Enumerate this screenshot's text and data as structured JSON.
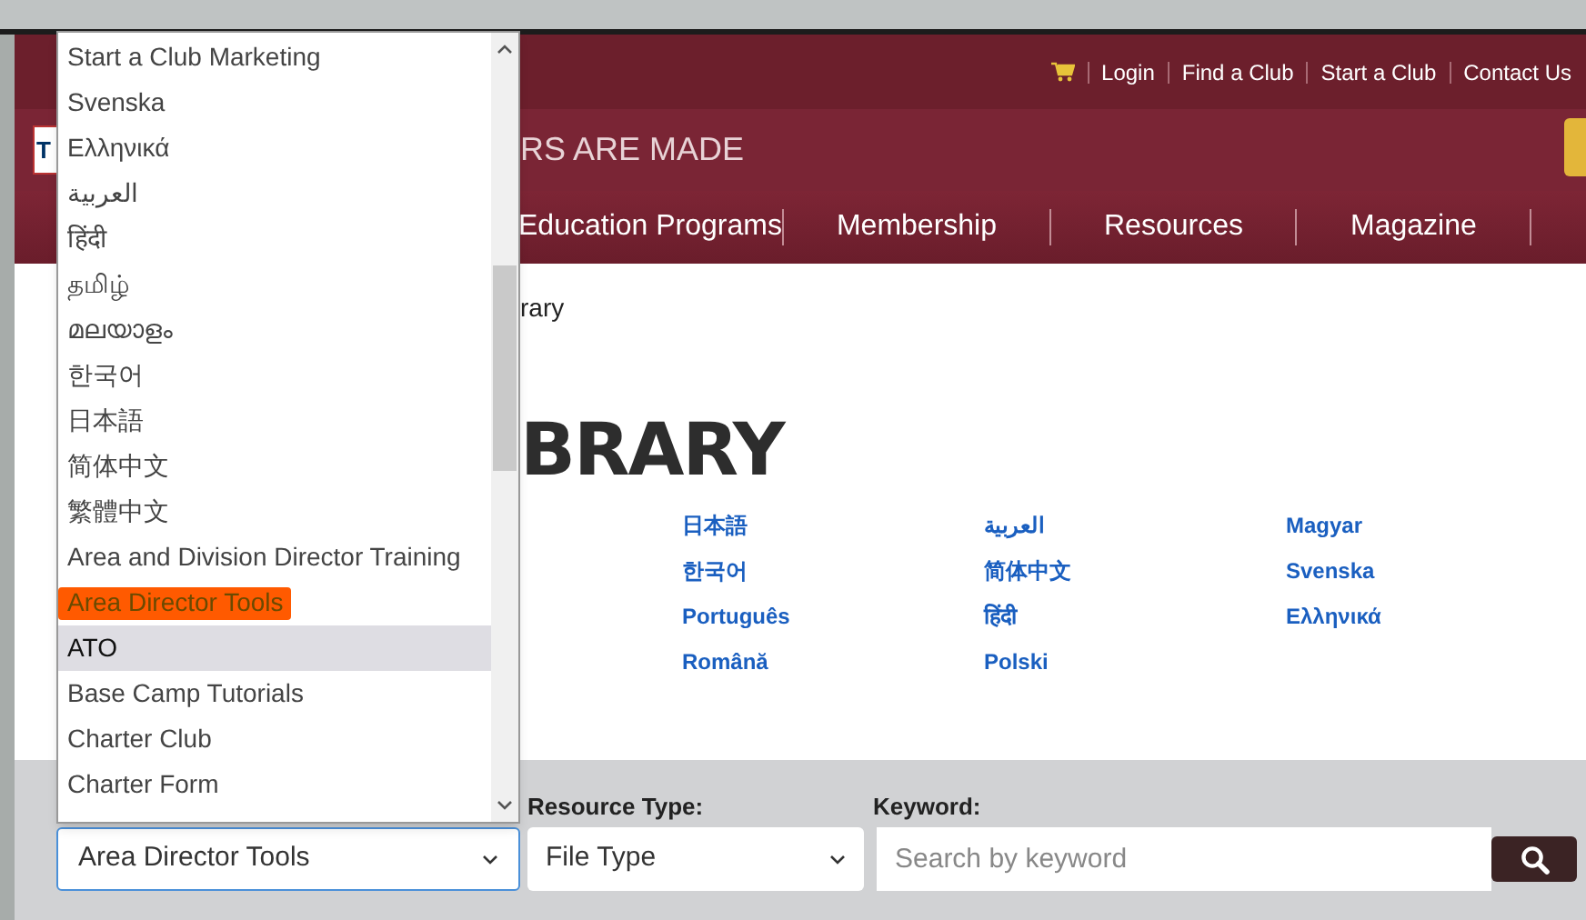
{
  "top_bar": {
    "links": [
      "Login",
      "Find a Club",
      "Start a Club",
      "Contact Us"
    ]
  },
  "header": {
    "logo_letter": "T",
    "tagline": "RS ARE MADE"
  },
  "nav": [
    "Education Programs",
    "Membership",
    "Resources",
    "Magazine"
  ],
  "breadcrumb": "rary",
  "heading": "BRARY",
  "languages": [
    [
      "日本語",
      "한국어",
      "Português",
      "Română"
    ],
    [
      "العربية",
      "简体中文",
      "हिंदी",
      "Polski"
    ],
    [
      "Magyar",
      "Svenska",
      "Ελληνικά"
    ]
  ],
  "filters": {
    "category": {
      "value": "Area Director Tools",
      "focused": true
    },
    "resource_type": {
      "label": "Resource Type:",
      "value": "File Type"
    },
    "keyword": {
      "label": "Keyword:",
      "placeholder": "Search by keyword"
    }
  },
  "dropdown": {
    "items": [
      {
        "label": "Start a Club Marketing",
        "selected": false,
        "annotated": false
      },
      {
        "label": "Svenska",
        "selected": false,
        "annotated": false
      },
      {
        "label": "Ελληνικά",
        "selected": false,
        "annotated": false
      },
      {
        "label": "العربية",
        "selected": false,
        "annotated": false
      },
      {
        "label": "हिंदी",
        "selected": false,
        "annotated": false
      },
      {
        "label": "தமிழ்",
        "selected": false,
        "annotated": false
      },
      {
        "label": "മലയാളം",
        "selected": false,
        "annotated": false
      },
      {
        "label": "한국어",
        "selected": false,
        "annotated": false
      },
      {
        "label": "日本語",
        "selected": false,
        "annotated": false
      },
      {
        "label": "简体中文",
        "selected": false,
        "annotated": false
      },
      {
        "label": "繁體中文",
        "selected": false,
        "annotated": false
      },
      {
        "label": "Area and Division Director Training",
        "selected": false,
        "annotated": false
      },
      {
        "label": "Area Director Tools",
        "selected": false,
        "annotated": true
      },
      {
        "label": "ATO",
        "selected": true,
        "annotated": false
      },
      {
        "label": "Base Camp Tutorials",
        "selected": false,
        "annotated": false
      },
      {
        "label": "Charter Club",
        "selected": false,
        "annotated": false
      },
      {
        "label": "Charter Form",
        "selected": false,
        "annotated": false
      }
    ]
  }
}
